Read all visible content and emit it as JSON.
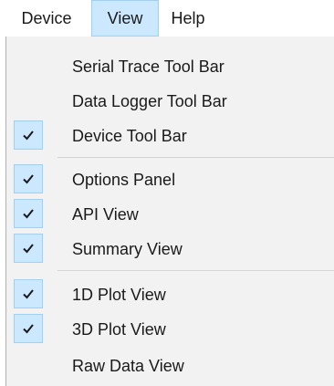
{
  "menubar": {
    "items": [
      {
        "label": "Device"
      },
      {
        "label": "View"
      },
      {
        "label": "Help"
      }
    ]
  },
  "view_menu": {
    "items": [
      {
        "label": "Serial Trace Tool Bar",
        "checked": false
      },
      {
        "label": "Data Logger Tool Bar",
        "checked": false
      },
      {
        "label": "Device Tool Bar",
        "checked": true
      },
      {
        "label": "Options Panel",
        "checked": true
      },
      {
        "label": "API View",
        "checked": true
      },
      {
        "label": "Summary View",
        "checked": true
      },
      {
        "label": "1D Plot View",
        "checked": true
      },
      {
        "label": "3D Plot View",
        "checked": true
      },
      {
        "label": "Raw Data View",
        "checked": false
      }
    ]
  },
  "colors": {
    "highlight": "#cce8ff",
    "highlight_border": "#99d1ff",
    "menu_background": "#f2f2f2"
  },
  "icons": {
    "checkmark": "check-icon"
  }
}
